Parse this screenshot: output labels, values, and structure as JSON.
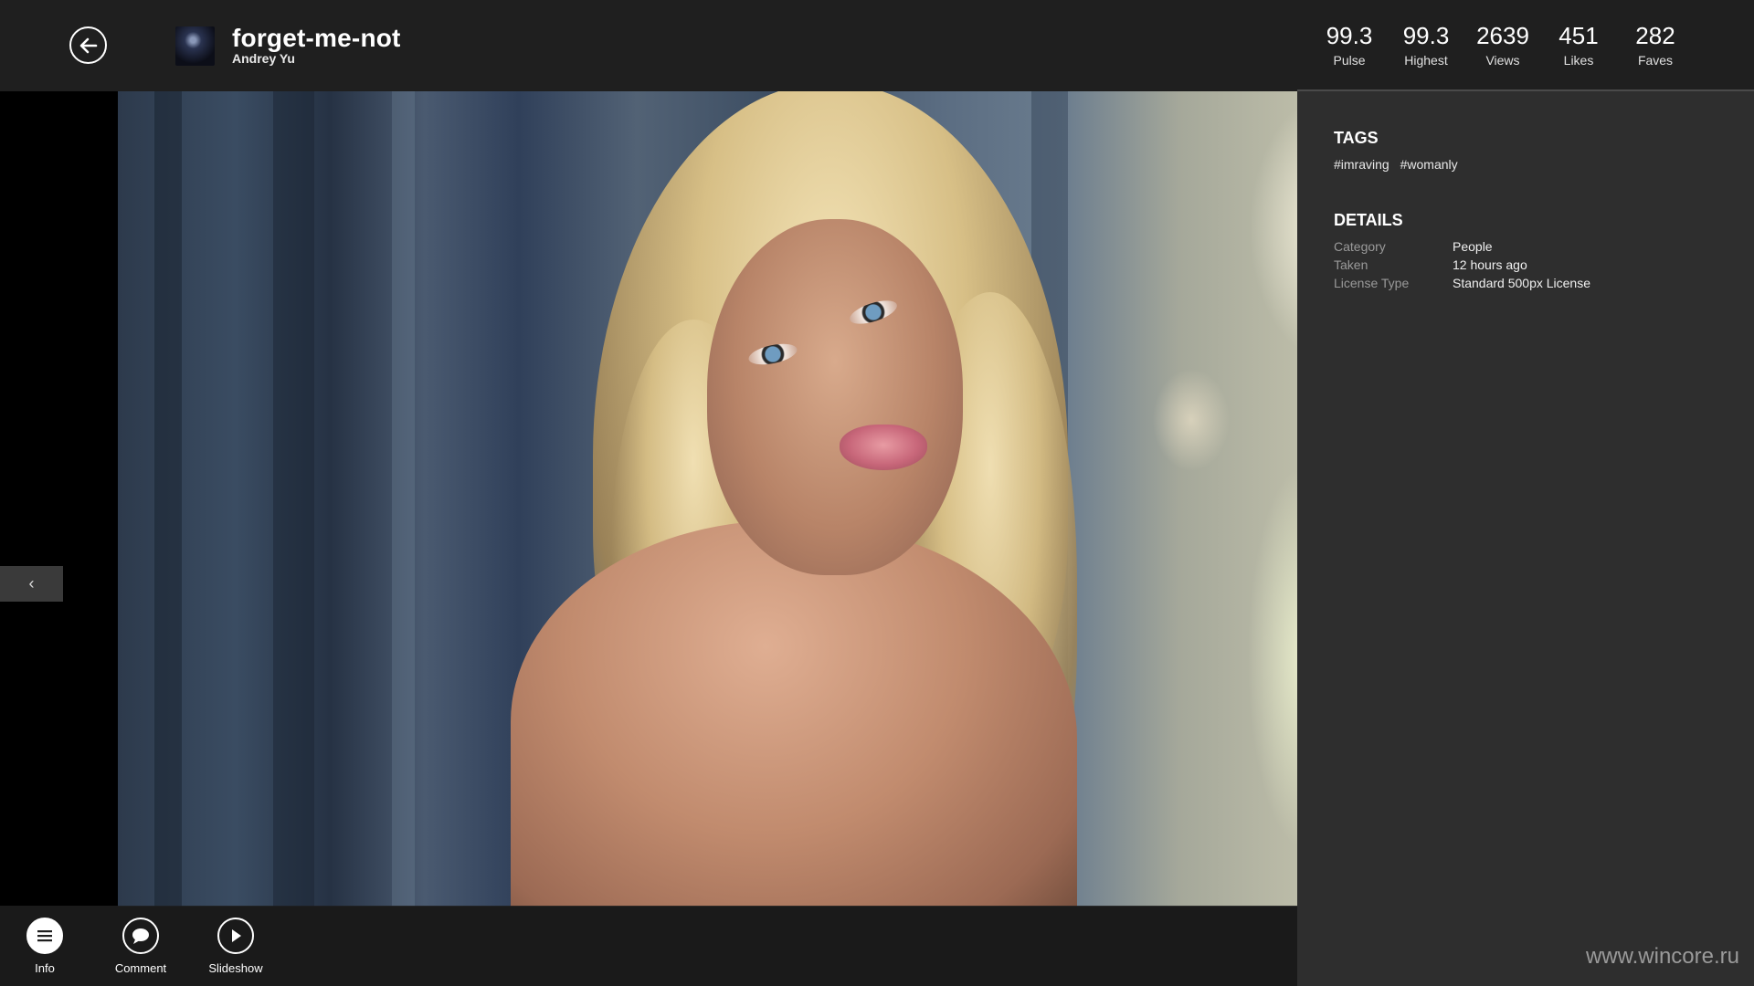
{
  "header": {
    "title": "forget-me-not",
    "author": "Andrey Yu"
  },
  "stats": [
    {
      "value": "99.3",
      "label": "Pulse"
    },
    {
      "value": "99.3",
      "label": "Highest"
    },
    {
      "value": "2639",
      "label": "Views"
    },
    {
      "value": "451",
      "label": "Likes"
    },
    {
      "value": "282",
      "label": "Faves"
    }
  ],
  "tags": {
    "heading": "TAGS",
    "items": [
      "#imraving",
      "#womanly"
    ]
  },
  "details": {
    "heading": "DETAILS",
    "rows": [
      {
        "key": "Category",
        "value": "People"
      },
      {
        "key": "Taken",
        "value": "12 hours ago"
      },
      {
        "key": "License Type",
        "value": "Standard 500px License"
      }
    ]
  },
  "appbar": {
    "info_label": "Info",
    "comment_label": "Comment",
    "slideshow_label": "Slideshow"
  },
  "nav": {
    "prev_glyph": "‹"
  },
  "watermark": "www.wincore.ru",
  "colors": {
    "header_bg": "#1f1f1f",
    "panel_bg": "#2e2e2e",
    "text": "#ffffff",
    "muted": "#9a9a9a"
  }
}
